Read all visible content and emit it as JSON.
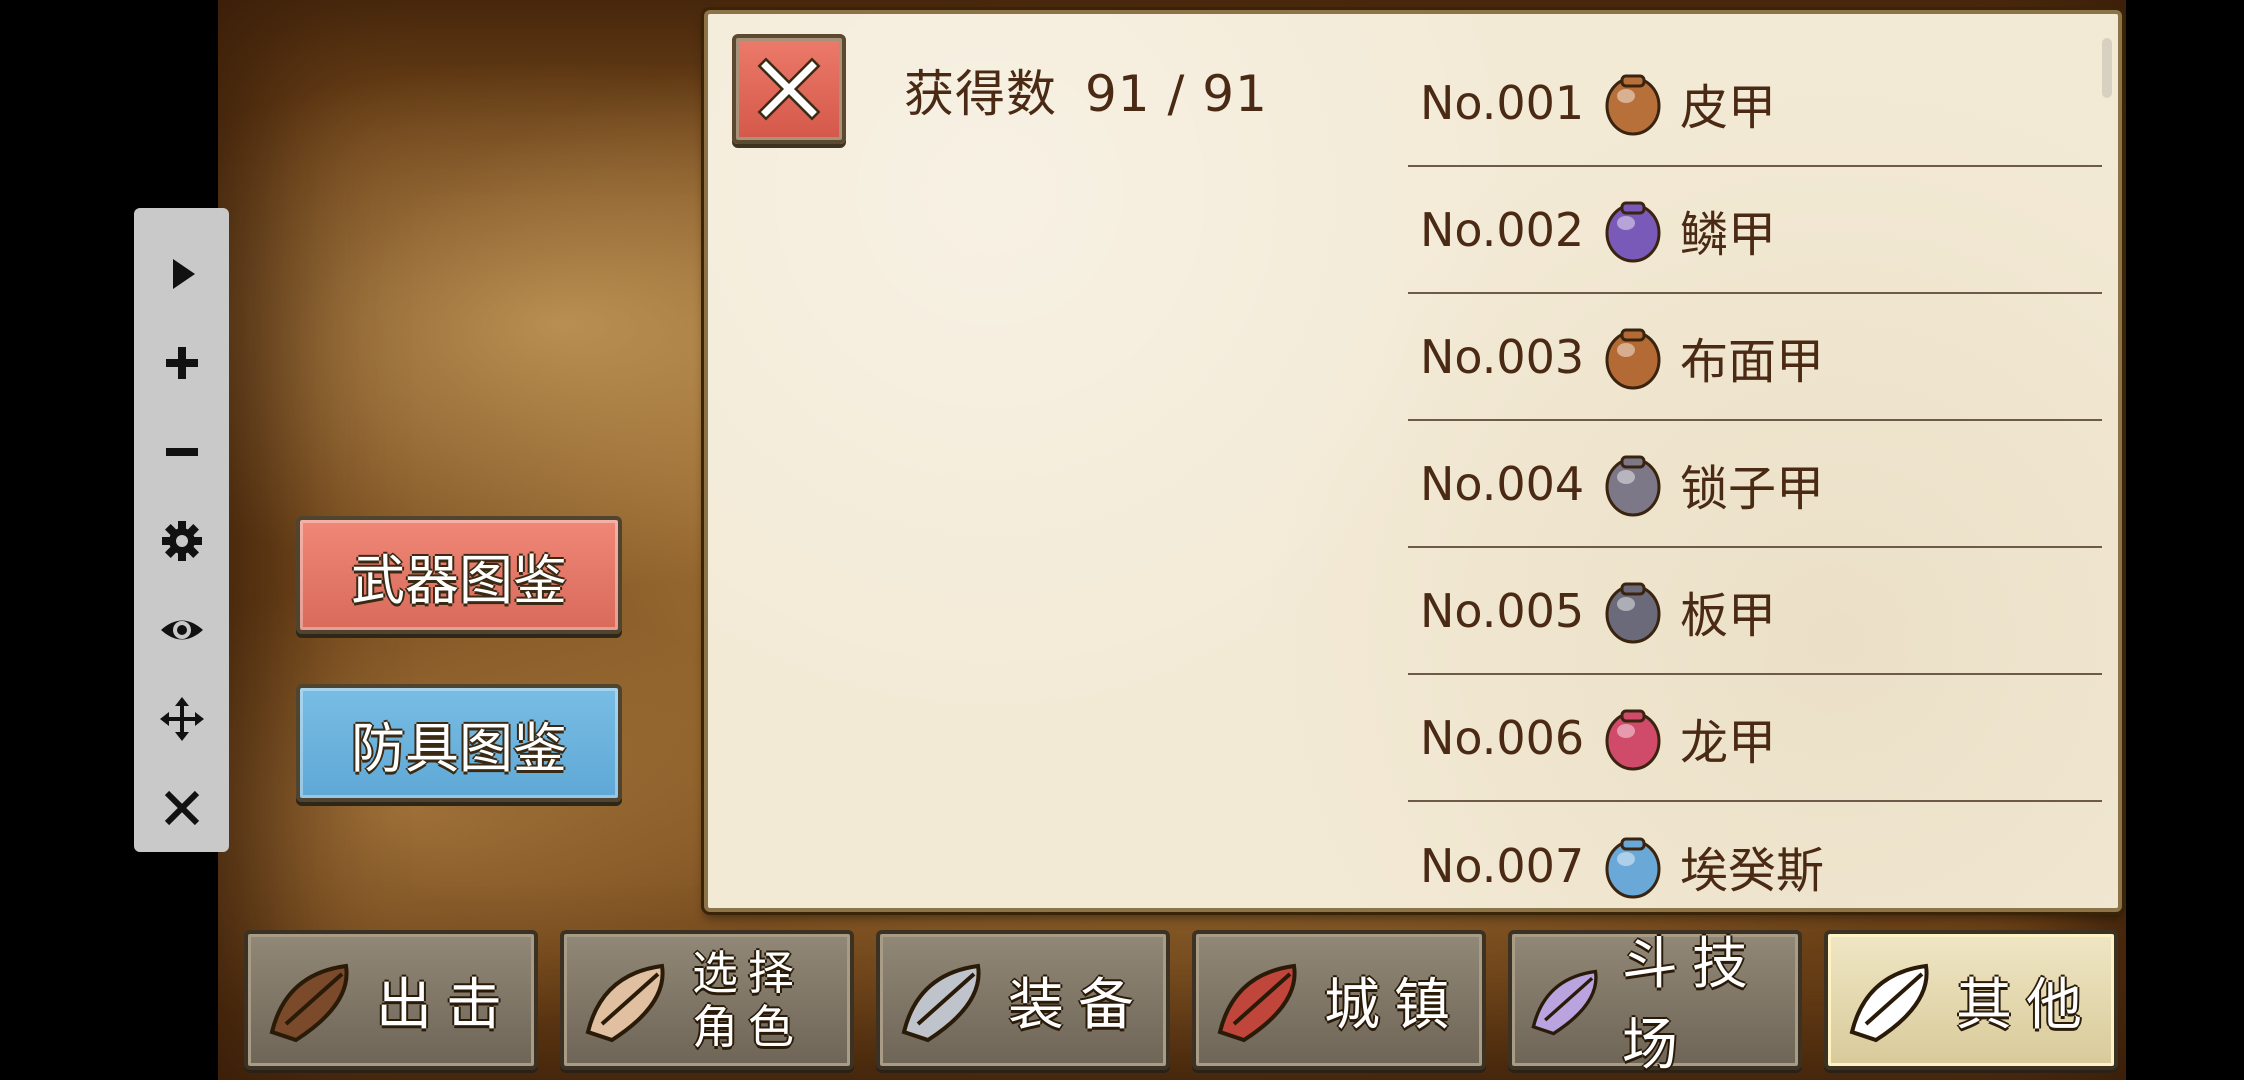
{
  "toolbar": {
    "buttons": [
      {
        "icon": "play-icon"
      },
      {
        "icon": "plus-icon"
      },
      {
        "icon": "minus-icon"
      },
      {
        "icon": "gear-icon"
      },
      {
        "icon": "eye-icon"
      },
      {
        "icon": "move-icon"
      },
      {
        "icon": "close-icon"
      }
    ]
  },
  "panel": {
    "count_label": "获得数",
    "count_value": "91 / 91",
    "items": [
      {
        "no": "No.001",
        "name": "皮甲",
        "icon": "leather-armor-icon",
        "color": "#b8703a"
      },
      {
        "no": "No.002",
        "name": "鳞甲",
        "icon": "scale-armor-icon",
        "color": "#7a5ab8"
      },
      {
        "no": "No.003",
        "name": "布面甲",
        "icon": "cloth-armor-icon",
        "color": "#b46a34"
      },
      {
        "no": "No.004",
        "name": "锁子甲",
        "icon": "chain-mail-icon",
        "color": "#7c7888"
      },
      {
        "no": "No.005",
        "name": "板甲",
        "icon": "plate-armor-icon",
        "color": "#6a6a7a"
      },
      {
        "no": "No.006",
        "name": "龙甲",
        "icon": "dragon-armor-icon",
        "color": "#d04a6a"
      },
      {
        "no": "No.007",
        "name": "埃癸斯",
        "icon": "aegis-icon",
        "color": "#6aa8d8"
      }
    ]
  },
  "side_buttons": {
    "weapon_label": "武器图鉴",
    "armor_label": "防具图鉴"
  },
  "nav": {
    "tabs": [
      {
        "label": "出击",
        "icon": "sortie-icon"
      },
      {
        "label": "选择\n角色",
        "icon": "character-select-icon"
      },
      {
        "label": "装备",
        "icon": "equipment-icon"
      },
      {
        "label": "城镇",
        "icon": "town-icon"
      },
      {
        "label": "斗技场",
        "icon": "arena-icon"
      },
      {
        "label": "其他",
        "icon": "other-icon"
      }
    ]
  },
  "colors": {
    "weapon_button": "#e77a6a",
    "armor_button": "#6cb3de",
    "close_button": "#e06b5c",
    "text_brown": "#4a2a14"
  }
}
